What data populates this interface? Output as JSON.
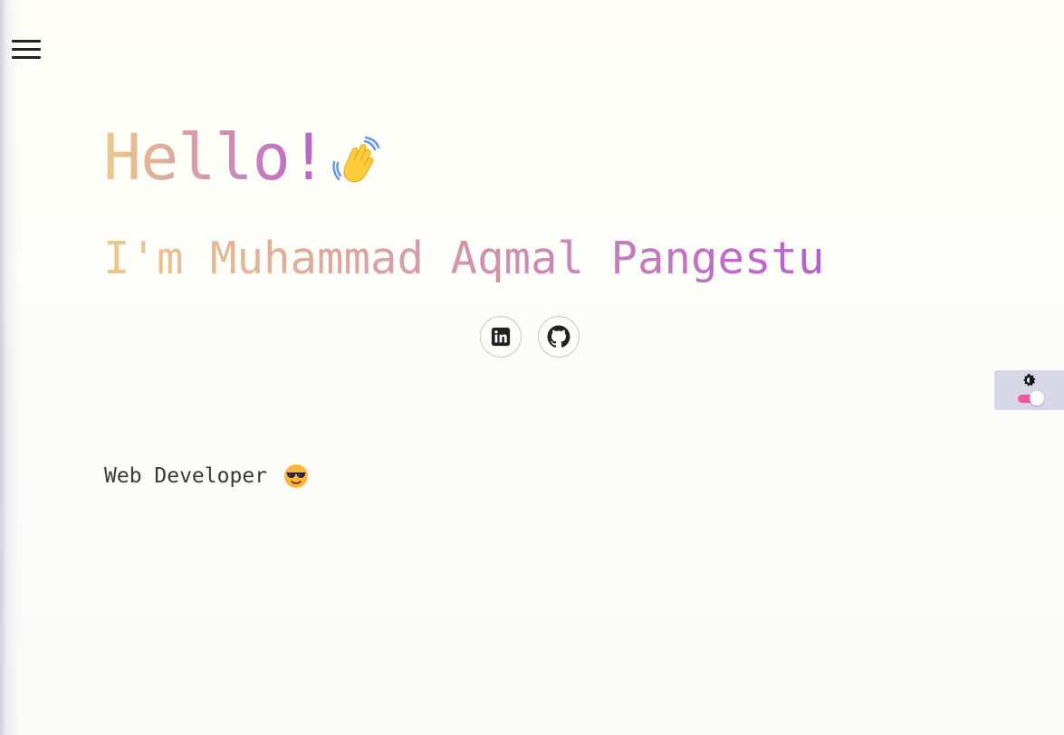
{
  "nav": {
    "menu_icon": "hamburger-menu-icon"
  },
  "hero": {
    "greeting": "Hello!",
    "greeting_emoji": "waving-hand-icon",
    "name_line": "I'm Muhammad Aqmal Pangestu",
    "role": "Web Developer",
    "role_emoji": "smiling-face-with-sunglasses-icon",
    "gradient_colors": [
      "#ecc98a",
      "#d49aa8",
      "#b55fd0"
    ]
  },
  "socials": [
    {
      "icon": "linkedin-icon"
    },
    {
      "icon": "github-icon"
    }
  ],
  "theme_switch": {
    "icon": "brightness-icon",
    "enabled": true,
    "track_color": "#e85a9a"
  }
}
